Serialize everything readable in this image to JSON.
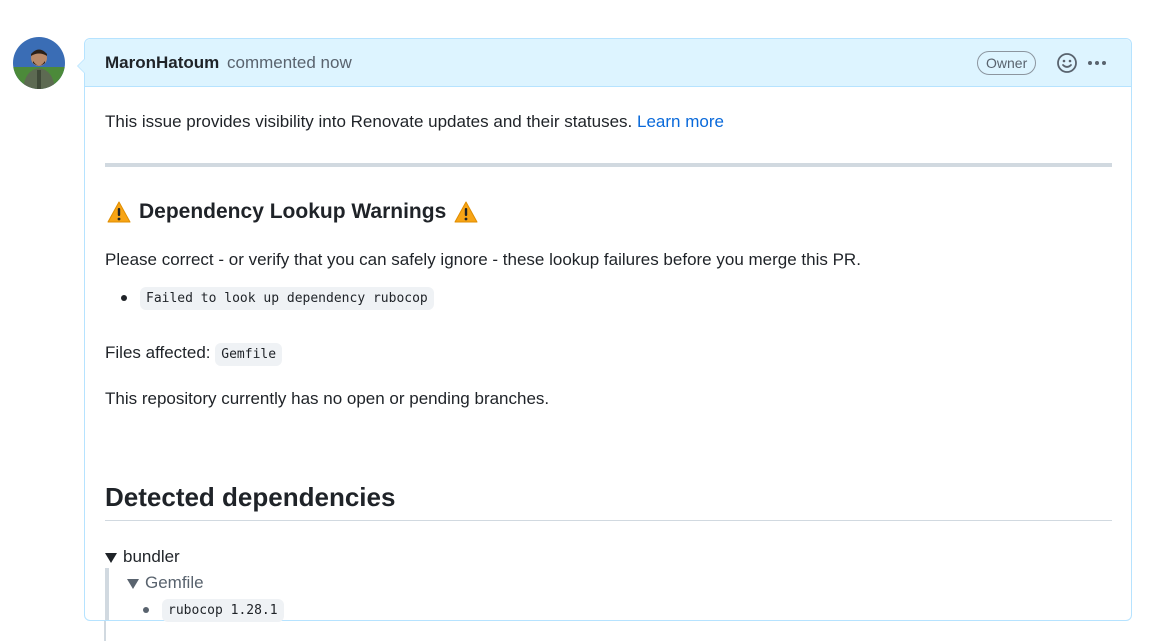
{
  "comment": {
    "author": "MaronHatoum",
    "meta": "commented now",
    "badge": "Owner",
    "icons": {
      "avatar": "avatar",
      "reaction": "smiley-icon",
      "more": "kebab-horizontal-icon"
    }
  },
  "body": {
    "intro_text": "This issue provides visibility into Renovate updates and their statuses.",
    "learn_more": "Learn more",
    "warnings_heading": "Dependency Lookup Warnings",
    "warnings_icon": "warning-icon",
    "correct_text": "Please correct - or verify that you can safely ignore - these lookup failures before you merge this PR.",
    "failures": [
      "Failed to look up dependency rubocop"
    ],
    "files_affected_label": "Files affected:",
    "files_affected": [
      "Gemfile"
    ],
    "branches_text": "This repository currently has no open or pending branches.",
    "detected_heading": "Detected dependencies",
    "managers": [
      {
        "name": "bundler",
        "files": [
          {
            "name": "Gemfile",
            "deps": [
              "rubocop 1.28.1"
            ]
          }
        ]
      }
    ]
  },
  "colors": {
    "header_bg": "#ddf4ff",
    "border": "#b6e3ff",
    "link": "#0969da",
    "warning": "#f7a415"
  }
}
